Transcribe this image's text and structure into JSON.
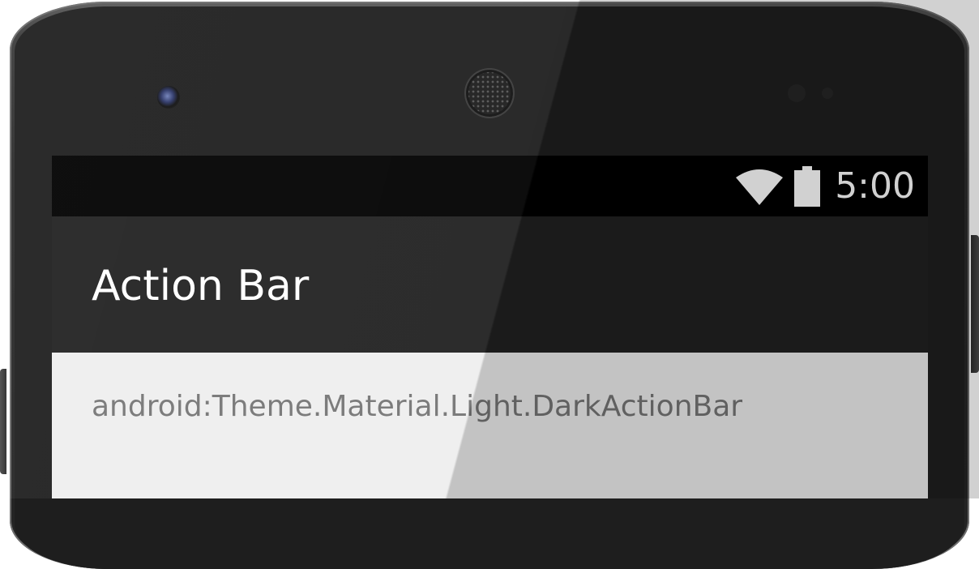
{
  "status_bar": {
    "time": "5:00",
    "icons": [
      "wifi-icon",
      "battery-icon"
    ]
  },
  "action_bar": {
    "title": "Action Bar",
    "background": "#212121"
  },
  "content": {
    "theme_label": "android:Theme.Material.Light.DarkActionBar",
    "background": "#eeeeee"
  },
  "colors": {
    "status_bar": "#000000",
    "title_text": "#ffffff",
    "body_text": "#757575"
  }
}
